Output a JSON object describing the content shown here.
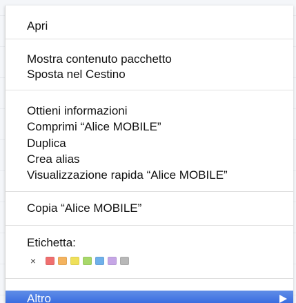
{
  "menu": {
    "items": [
      "Apri",
      "Mostra contenuto pacchetto",
      "Sposta nel Cestino",
      "Ottieni informazioni",
      "Comprimi “Alice MOBILE”",
      "Duplica",
      "Crea alias",
      "Visualizzazione rapida “Alice MOBILE”",
      "Copia “Alice MOBILE”",
      "Etichetta:",
      "Altro"
    ],
    "label_section": {
      "clear_glyph": "×",
      "swatches": [
        {
          "name": "red",
          "color": "#ef6f6f"
        },
        {
          "name": "orange",
          "color": "#f4b35f"
        },
        {
          "name": "yellow",
          "color": "#efe05a"
        },
        {
          "name": "green",
          "color": "#a8d86a"
        },
        {
          "name": "blue",
          "color": "#6fb0ea"
        },
        {
          "name": "purple",
          "color": "#c6a6e6"
        },
        {
          "name": "gray",
          "color": "#b8b8b8"
        }
      ]
    },
    "highlight_color": "#3f6fe0",
    "submenu_icon": "right-arrow-icon"
  }
}
